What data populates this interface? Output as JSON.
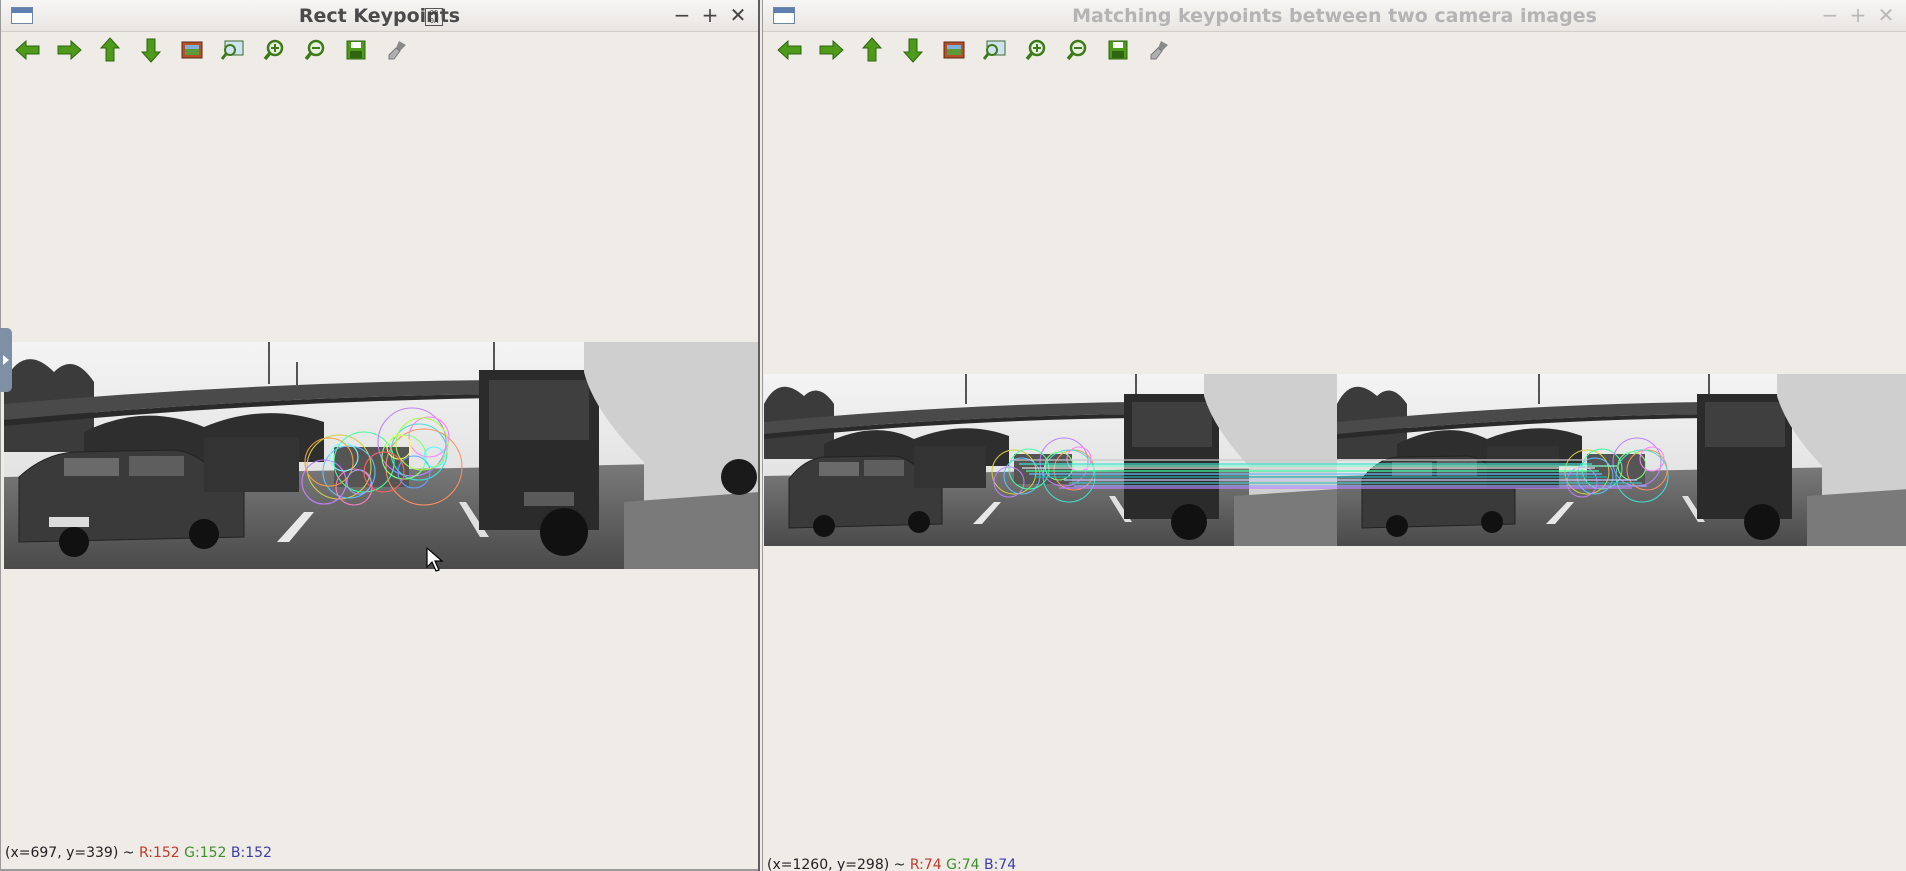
{
  "window1": {
    "title": "Rect Keypoints",
    "title_glyph": "0 0\n0 A",
    "controls": {
      "minimize": "−",
      "maximize": "+",
      "close": "✕"
    },
    "toolbar": [
      {
        "name": "pan-left-icon"
      },
      {
        "name": "pan-right-icon"
      },
      {
        "name": "pan-up-icon"
      },
      {
        "name": "pan-down-icon"
      },
      {
        "name": "zoom-to-fit-icon"
      },
      {
        "name": "zoom-to-original-icon"
      },
      {
        "name": "zoom-in-icon"
      },
      {
        "name": "zoom-out-icon"
      },
      {
        "name": "save-icon"
      },
      {
        "name": "properties-icon"
      }
    ],
    "status": {
      "coords": "(x=697, y=339) ~",
      "r": "R:152",
      "g": "G:152",
      "b": "B:152"
    }
  },
  "window2": {
    "title": "Matching keypoints between two camera images",
    "controls": {
      "minimize": "−",
      "maximize": "+",
      "close": "✕"
    },
    "status": {
      "coords": "(x=1260, y=298) ~",
      "r": "R:74",
      "g": "G:74",
      "b": "B:74"
    }
  },
  "colors": {
    "window_bg": "#efece8",
    "toolbar_green": "#4e9a1a",
    "active_title": "#4a4a4a",
    "inactive_title": "#b4b4b4"
  }
}
